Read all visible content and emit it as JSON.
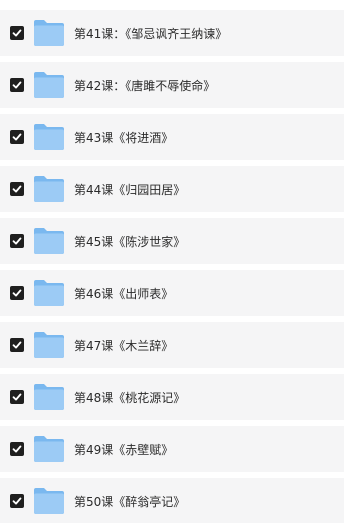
{
  "items": [
    {
      "label": "第41课：《邹忌讽齐王纳谏》",
      "checked": true,
      "icon": "folder-icon"
    },
    {
      "label": "第42课：《唐雎不辱使命》",
      "checked": true,
      "icon": "folder-icon"
    },
    {
      "label": "第43课《将进酒》",
      "checked": true,
      "icon": "folder-icon"
    },
    {
      "label": "第44课《归园田居》",
      "checked": true,
      "icon": "folder-icon"
    },
    {
      "label": "第45课《陈涉世家》",
      "checked": true,
      "icon": "folder-icon"
    },
    {
      "label": "第46课《出师表》",
      "checked": true,
      "icon": "folder-icon"
    },
    {
      "label": "第47课《木兰辞》",
      "checked": true,
      "icon": "folder-icon"
    },
    {
      "label": "第48课《桃花源记》",
      "checked": true,
      "icon": "folder-icon"
    },
    {
      "label": "第49课《赤壁赋》",
      "checked": true,
      "icon": "folder-icon"
    },
    {
      "label": "第50课《醉翁亭记》",
      "checked": true,
      "icon": "folder-icon"
    }
  ],
  "colors": {
    "row_background": "#f5f5f6",
    "checkbox": "#1f1f1f",
    "folder_back": "#7ab8ef",
    "folder_front": "#9ccbf5"
  }
}
